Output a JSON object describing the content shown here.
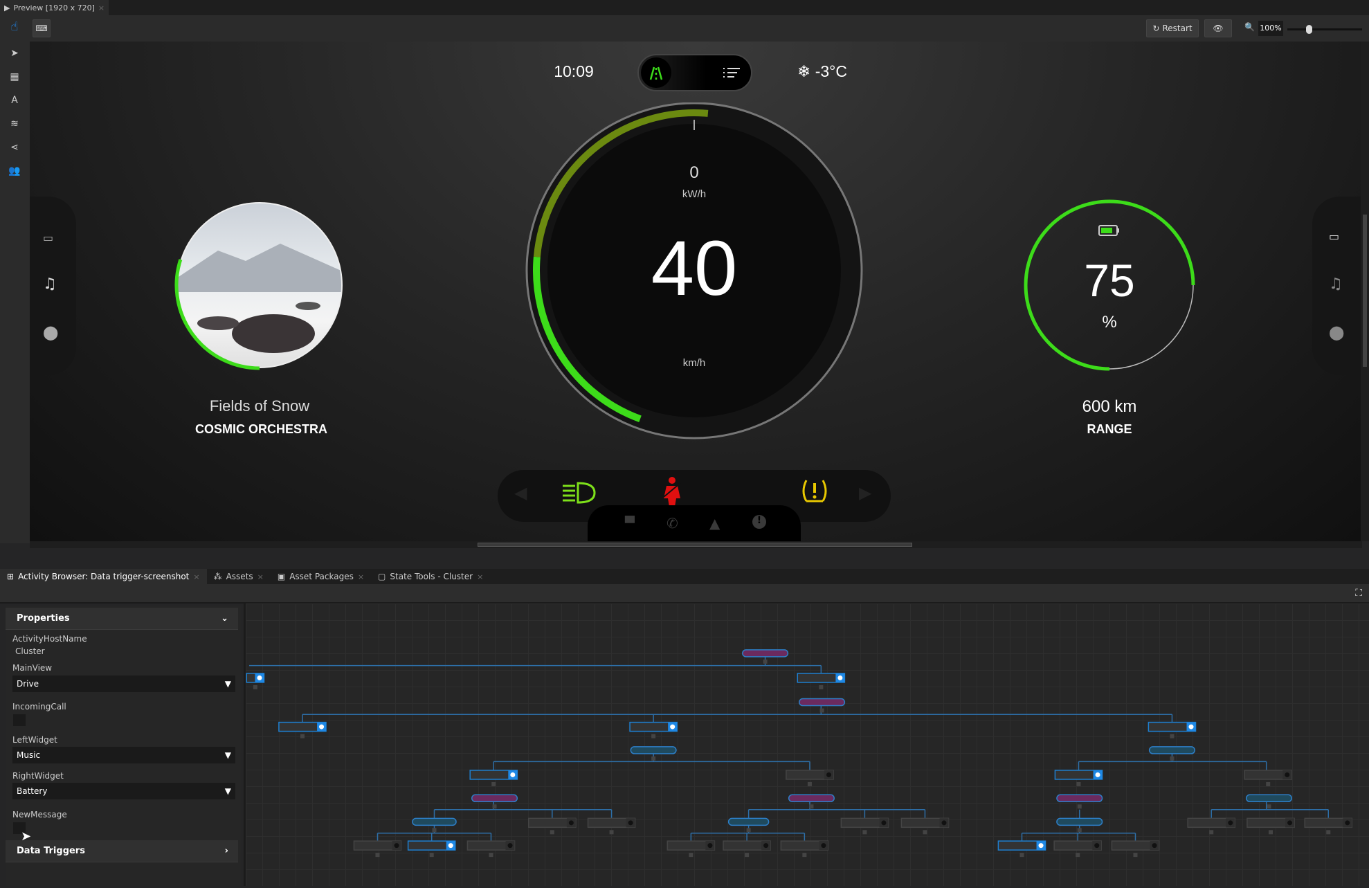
{
  "window": {
    "tab_title": "Preview [1920 x 720]"
  },
  "toolbar": {
    "restart_label": "Restart",
    "zoom_level": "100%",
    "zoom_slider_fraction": 0.25
  },
  "dashboard": {
    "time": "10:09",
    "temperature": "-3°C",
    "power_value": "0",
    "power_unit": "kW/h",
    "speed_value": "40",
    "speed_unit": "km/h",
    "power_arc_fraction": 0.45,
    "music": {
      "song": "Fields of Snow",
      "artist": "COSMIC ORCHESTRA",
      "progress_fraction": 0.3
    },
    "battery": {
      "value": "75",
      "unit": "%",
      "range": "600 km",
      "range_label": "RANGE",
      "level_fraction": 0.75
    },
    "colors": {
      "green": "#3ddc1a",
      "red": "#e01010",
      "yellow": "#e8c800"
    },
    "warning_icons": [
      "headlight-icon",
      "seatbelt-icon",
      "tire-pressure-icon"
    ],
    "tray_icons": [
      "message-icon",
      "phone-icon",
      "warning-icon",
      "alert-icon"
    ]
  },
  "panel_tabs": [
    {
      "label": "Activity Browser: Data trigger-screenshot",
      "icon": "hierarchy-icon"
    },
    {
      "label": "Assets",
      "icon": "assets-icon"
    },
    {
      "label": "Asset Packages",
      "icon": "package-icon"
    },
    {
      "label": "State Tools - Cluster",
      "icon": "state-icon"
    }
  ],
  "properties": {
    "header": "Properties",
    "activity_host_label": "ActivityHostName",
    "activity_host_value": "Cluster",
    "main_view_label": "MainView",
    "main_view_value": "Drive",
    "incoming_call_label": "IncomingCall",
    "left_widget_label": "LeftWidget",
    "left_widget_value": "Music",
    "right_widget_label": "RightWidget",
    "right_widget_value": "Battery",
    "new_message_label": "NewMessage",
    "data_triggers": "Data Triggers"
  }
}
